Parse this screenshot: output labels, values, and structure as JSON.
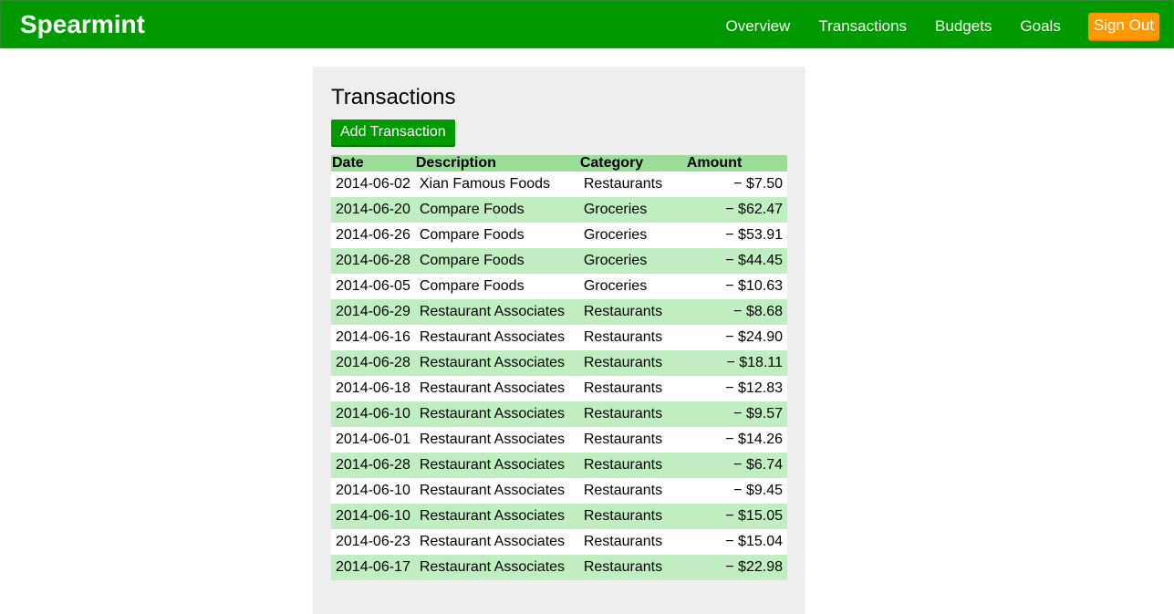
{
  "nav": {
    "brand": "Spearmint",
    "links": [
      "Overview",
      "Transactions",
      "Budgets",
      "Goals"
    ],
    "sign_out": "Sign Out"
  },
  "colors": {
    "navbar": "#009900",
    "sign_out": "#ff9900",
    "row_alt": "#c0eec0",
    "header_row": "#99dd99",
    "panel": "#eeeeee"
  },
  "main": {
    "title": "Transactions",
    "add_button": "Add Transaction",
    "table": {
      "headers": [
        "Date",
        "Description",
        "Category",
        "Amount"
      ],
      "rows": [
        [
          "2014-06-02",
          "Xian Famous Foods",
          "Restaurants",
          "− $7.50"
        ],
        [
          "2014-06-20",
          "Compare Foods",
          "Groceries",
          "− $62.47"
        ],
        [
          "2014-06-26",
          "Compare Foods",
          "Groceries",
          "− $53.91"
        ],
        [
          "2014-06-28",
          "Compare Foods",
          "Groceries",
          "− $44.45"
        ],
        [
          "2014-06-05",
          "Compare Foods",
          "Groceries",
          "− $10.63"
        ],
        [
          "2014-06-29",
          "Restaurant Associates",
          "Restaurants",
          "− $8.68"
        ],
        [
          "2014-06-16",
          "Restaurant Associates",
          "Restaurants",
          "− $24.90"
        ],
        [
          "2014-06-28",
          "Restaurant Associates",
          "Restaurants",
          "− $18.11"
        ],
        [
          "2014-06-18",
          "Restaurant Associates",
          "Restaurants",
          "− $12.83"
        ],
        [
          "2014-06-10",
          "Restaurant Associates",
          "Restaurants",
          "− $9.57"
        ],
        [
          "2014-06-01",
          "Restaurant Associates",
          "Restaurants",
          "− $14.26"
        ],
        [
          "2014-06-28",
          "Restaurant Associates",
          "Restaurants",
          "− $6.74"
        ],
        [
          "2014-06-10",
          "Restaurant Associates",
          "Restaurants",
          "− $9.45"
        ],
        [
          "2014-06-10",
          "Restaurant Associates",
          "Restaurants",
          "− $15.05"
        ],
        [
          "2014-06-23",
          "Restaurant Associates",
          "Restaurants",
          "− $15.04"
        ],
        [
          "2014-06-17",
          "Restaurant Associates",
          "Restaurants",
          "− $22.98"
        ]
      ]
    }
  }
}
